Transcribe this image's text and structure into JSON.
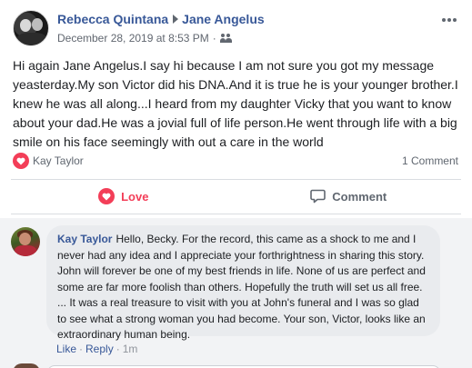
{
  "post": {
    "author": "Rebecca Quintana",
    "recipient": "Jane Angelus",
    "timestamp": "December 28, 2019 at 8:53 PM",
    "meta_separator": "·",
    "audience_icon": "friends-group-icon",
    "body": "Hi again Jane Angelus.I say hi because I am not sure you got my message yeasterday.My son Victor did his DNA.And it is true he is your younger brother.I knew he was all along...I heard from my daughter Vicky that you want to know about your dad.He was a jovial full of life person.He went through life with a big smile on his face seemingly with out a care in the world",
    "reactor": "Kay Taylor",
    "reaction_icon": "love-reaction-icon",
    "comment_count": "1 Comment"
  },
  "actions": {
    "love_label": "Love",
    "comment_label": "Comment"
  },
  "comment": {
    "author": "Kay Taylor",
    "text": "Hello, Becky. For the record, this came as a shock to me and I never had any idea and I appreciate your forthrightness in sharing this story. John will forever be one of my best friends in life. None of us are perfect and some are far more foolish than others. Hopefully the truth will set us all free. ... It was a real treasure to visit with you at John's funeral and I was so glad to see what a strong woman you had become. Your son, Victor, looks like an extraordinary human being.",
    "like_label": "Like",
    "reply_label": "Reply",
    "separator": "·",
    "time": "1m"
  },
  "colors": {
    "link_blue": "#385898",
    "love_red": "#f33e58",
    "secondary_text": "#616770",
    "comment_bg": "#e9ebee"
  }
}
